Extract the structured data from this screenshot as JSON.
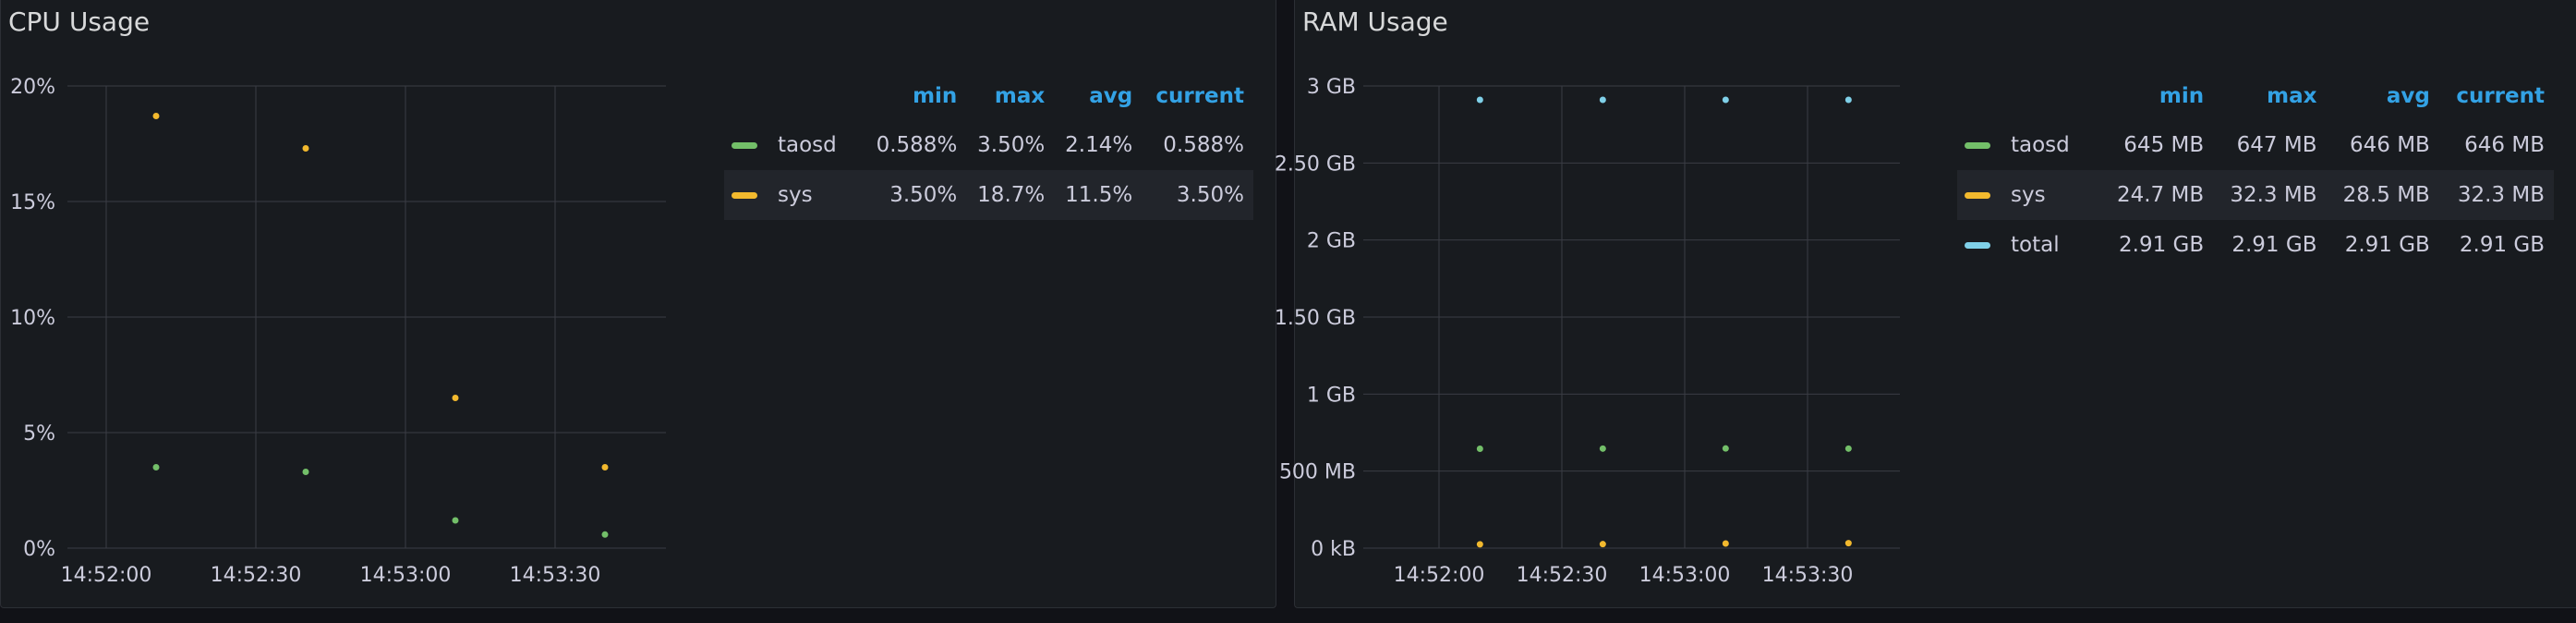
{
  "colors": {
    "taosd": "#73bf69",
    "sys": "#fade2a",
    "total": "#8ab8ff",
    "grid": "#3a3d44",
    "accent": "#33a2e5"
  },
  "cpu_panel": {
    "title": "CPU Usage",
    "legend_headers": [
      "min",
      "max",
      "avg",
      "current"
    ],
    "legend_rows": [
      {
        "name": "taosd",
        "color": "#73bf69",
        "min": "0.588%",
        "max": "3.50%",
        "avg": "2.14%",
        "current": "0.588%"
      },
      {
        "name": "sys",
        "color": "#f2b92e",
        "min": "3.50%",
        "max": "18.7%",
        "avg": "11.5%",
        "current": "3.50%"
      }
    ]
  },
  "ram_panel": {
    "title": "RAM Usage",
    "legend_headers": [
      "min",
      "max",
      "avg",
      "current"
    ],
    "legend_rows": [
      {
        "name": "taosd",
        "color": "#73bf69",
        "min": "645 MB",
        "max": "647 MB",
        "avg": "646 MB",
        "current": "646 MB"
      },
      {
        "name": "sys",
        "color": "#f2b92e",
        "min": "24.7 MB",
        "max": "32.3 MB",
        "avg": "28.5 MB",
        "current": "32.3 MB"
      },
      {
        "name": "total",
        "color": "#7fd0e8",
        "min": "2.91 GB",
        "max": "2.91 GB",
        "avg": "2.91 GB",
        "current": "2.91 GB"
      }
    ]
  },
  "chart_data": [
    {
      "type": "scatter",
      "title": "CPU Usage",
      "x_ticks": [
        "14:52:00",
        "14:52:30",
        "14:53:00",
        "14:53:30"
      ],
      "y_ticks": [
        "0%",
        "5%",
        "10%",
        "15%",
        "20%"
      ],
      "ylim": [
        0,
        20
      ],
      "grid": true,
      "legend_position": "right",
      "series": [
        {
          "name": "taosd",
          "color": "#73bf69",
          "x": [
            "14:52:10",
            "14:52:40",
            "14:53:10",
            "14:53:40"
          ],
          "values": [
            3.5,
            3.3,
            1.2,
            0.588
          ]
        },
        {
          "name": "sys",
          "color": "#f2b92e",
          "x": [
            "14:52:10",
            "14:52:40",
            "14:53:10",
            "14:53:40"
          ],
          "values": [
            18.7,
            17.3,
            6.5,
            3.5
          ]
        }
      ]
    },
    {
      "type": "scatter",
      "title": "RAM Usage",
      "x_ticks": [
        "14:52:00",
        "14:52:30",
        "14:53:00",
        "14:53:30"
      ],
      "y_ticks": [
        "0 kB",
        "500 MB",
        "1 GB",
        "1.50 GB",
        "2 GB",
        "2.50 GB",
        "3 GB"
      ],
      "ylim": [
        0,
        3
      ],
      "y_unit": "GB",
      "grid": true,
      "legend_position": "right",
      "series": [
        {
          "name": "taosd",
          "color": "#73bf69",
          "x": [
            "14:52:10",
            "14:52:40",
            "14:53:10",
            "14:53:40"
          ],
          "values": [
            0.645,
            0.646,
            0.647,
            0.646
          ]
        },
        {
          "name": "sys",
          "color": "#f2b92e",
          "x": [
            "14:52:10",
            "14:52:40",
            "14:53:10",
            "14:53:40"
          ],
          "values": [
            0.0247,
            0.026,
            0.03,
            0.0323
          ]
        },
        {
          "name": "total",
          "color": "#7fd0e8",
          "x": [
            "14:52:10",
            "14:52:40",
            "14:53:10",
            "14:53:40"
          ],
          "values": [
            2.91,
            2.91,
            2.91,
            2.91
          ]
        }
      ]
    }
  ]
}
